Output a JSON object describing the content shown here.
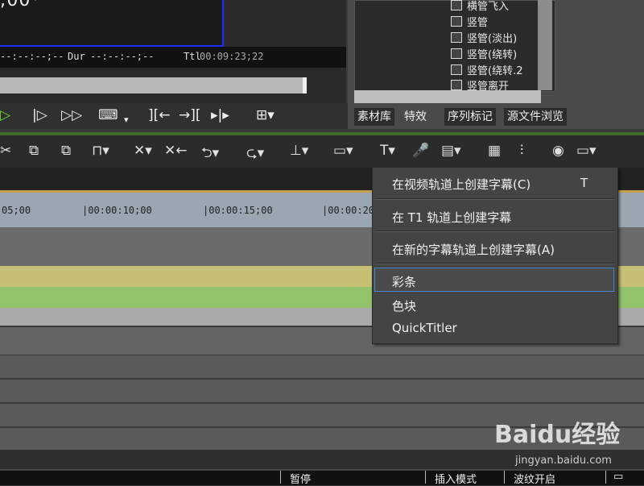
{
  "preview": {
    "timecode_big": ";00*  \"",
    "in_tc": "--:--:--;--",
    "dur_label": "Dur",
    "dur_value": "--:--:--;--",
    "ttl_label": "Ttl",
    "ttl_value": "00:09:23;22"
  },
  "library": {
    "items": [
      "横管飞入",
      "竖管",
      "竖管(淡出)",
      "竖管(绕转)",
      "竖管(绕转.2",
      "竖管离开"
    ],
    "tabs": [
      "素材库",
      "特效",
      "序列标记",
      "源文件浏览"
    ],
    "active_tab": 1
  },
  "transport_icons": [
    "play-icon",
    "step-forward-icon",
    "fast-forward-icon",
    "loop-icon",
    "mark-in-icon",
    "mark-out-icon",
    "split-icon",
    "add-icon"
  ],
  "toolbar_icons": [
    "cut-icon",
    "copy-icon",
    "paste-icon",
    "group-icon",
    "delete-icon",
    "ripple-delete-icon",
    "undo-icon",
    "redo-icon",
    "trim-icon",
    "transition-icon",
    "title-icon",
    "mic-icon",
    "render-icon",
    "grid-icon",
    "mixer-icon",
    "color-icon",
    "window-icon"
  ],
  "ruler": {
    "labels": [
      "05;00",
      "|00:00:10;00",
      "|00:00:15;00",
      "|00:00:20"
    ]
  },
  "menu": {
    "items": [
      {
        "label": "在视频轨道上创建字幕(C)",
        "shortcut": "T"
      },
      {
        "label": "在 T1 轨道上创建字幕",
        "shortcut": ""
      },
      {
        "label": "在新的字幕轨道上创建字幕(A)",
        "shortcut": ""
      },
      {
        "label": "彩条",
        "shortcut": ""
      },
      {
        "label": "色块",
        "shortcut": ""
      },
      {
        "label": "QuickTitler",
        "shortcut": ""
      }
    ]
  },
  "status": {
    "pause": "暂停",
    "insert_mode": "插入模式",
    "wave_on": "波纹开启"
  },
  "watermark": {
    "main": "Baidu经验",
    "sub": "jingyan.baidu.com"
  },
  "colors": {
    "accent_blue": "#1a2fff",
    "highlight_border": "#4a86c8",
    "track_yellow": "#c7bf74",
    "track_green": "#92c26a",
    "ruler": "#9aa7b3"
  }
}
